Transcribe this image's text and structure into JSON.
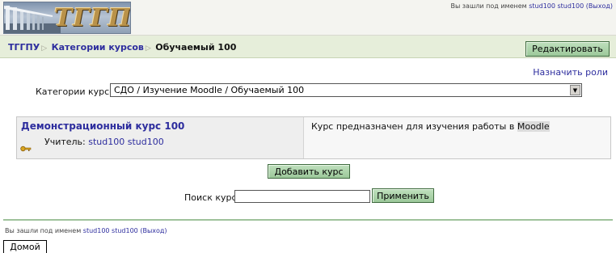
{
  "header": {
    "logo_text": "ТГГПУ",
    "login_prefix": "Вы зашли под именем",
    "login_user": "stud100 stud100",
    "login_exit": "(Выход)"
  },
  "navbar": {
    "crumbs": [
      "ТГГПУ",
      "Категории курсов",
      "Обучаемый 100"
    ],
    "separator": "▷",
    "edit_label": "Редактировать"
  },
  "assign_roles": "Назначить роли",
  "category": {
    "label": "Категории курсов:",
    "selected": "СДО / Изучение Moodle / Обучаемый 100"
  },
  "course": {
    "title": "Демонстрационный курс 100",
    "teacher_label": "Учитель:",
    "teacher_name": "stud100 stud100",
    "desc_prefix": "Курс предназначен для изучения работы в",
    "desc_highlight": "Moodle"
  },
  "add_course_label": "Добавить курс",
  "search": {
    "label": "Поиск курса:",
    "value": "",
    "apply_label": "Применить"
  },
  "footer": {
    "login_prefix": "Вы зашли под именем",
    "login_user": "stud100 stud100",
    "login_exit": "(Выход)",
    "home_label": "Домой"
  },
  "icons": {
    "dropdown": "chevron-down-icon",
    "key": "key-icon"
  }
}
